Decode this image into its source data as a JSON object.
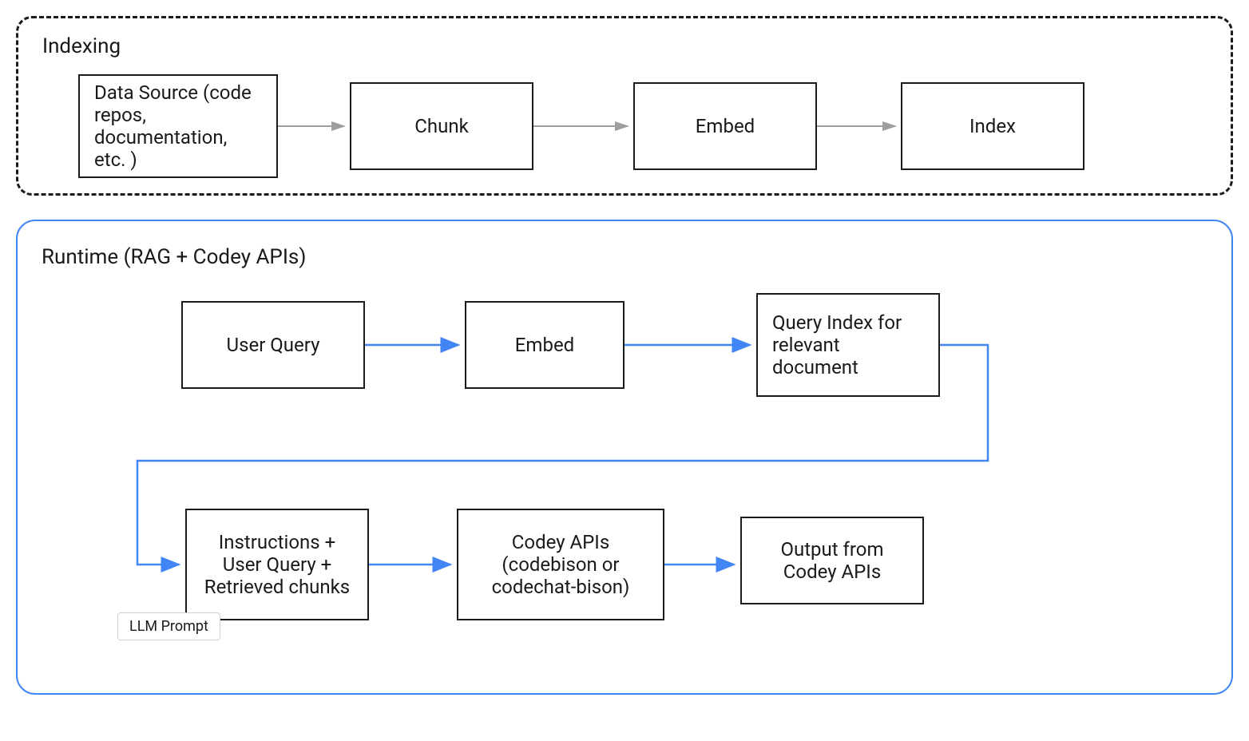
{
  "indexing": {
    "title": "Indexing",
    "boxes": {
      "data_source": "Data Source (code repos, documentation, etc. )",
      "chunk": "Chunk",
      "embed": "Embed",
      "index": "Index"
    }
  },
  "runtime": {
    "title": "Runtime (RAG + Codey APIs)",
    "boxes": {
      "user_query": "User Query",
      "embed": "Embed",
      "query_index": "Query Index for relevant document",
      "instructions": "Instructions + User Query + Retrieved chunks",
      "codey_apis": "Codey APIs (codebison or codechat-bison)",
      "output": "Output from Codey APIs"
    },
    "llm_prompt_label": "LLM Prompt"
  },
  "colors": {
    "gray_arrow": "#9e9e9e",
    "blue_arrow": "#4285f4",
    "blue_border": "#4285f4"
  }
}
